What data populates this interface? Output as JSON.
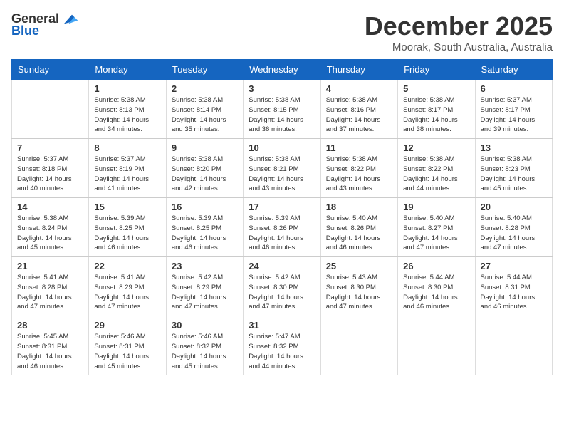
{
  "header": {
    "logo": {
      "general": "General",
      "blue": "Blue"
    },
    "title": "December 2025",
    "location": "Moorak, South Australia, Australia"
  },
  "days_of_week": [
    "Sunday",
    "Monday",
    "Tuesday",
    "Wednesday",
    "Thursday",
    "Friday",
    "Saturday"
  ],
  "weeks": [
    [
      {
        "day": "",
        "sunrise": "",
        "sunset": "",
        "daylight": ""
      },
      {
        "day": "1",
        "sunrise": "Sunrise: 5:38 AM",
        "sunset": "Sunset: 8:13 PM",
        "daylight": "Daylight: 14 hours and 34 minutes."
      },
      {
        "day": "2",
        "sunrise": "Sunrise: 5:38 AM",
        "sunset": "Sunset: 8:14 PM",
        "daylight": "Daylight: 14 hours and 35 minutes."
      },
      {
        "day": "3",
        "sunrise": "Sunrise: 5:38 AM",
        "sunset": "Sunset: 8:15 PM",
        "daylight": "Daylight: 14 hours and 36 minutes."
      },
      {
        "day": "4",
        "sunrise": "Sunrise: 5:38 AM",
        "sunset": "Sunset: 8:16 PM",
        "daylight": "Daylight: 14 hours and 37 minutes."
      },
      {
        "day": "5",
        "sunrise": "Sunrise: 5:38 AM",
        "sunset": "Sunset: 8:17 PM",
        "daylight": "Daylight: 14 hours and 38 minutes."
      },
      {
        "day": "6",
        "sunrise": "Sunrise: 5:37 AM",
        "sunset": "Sunset: 8:17 PM",
        "daylight": "Daylight: 14 hours and 39 minutes."
      }
    ],
    [
      {
        "day": "7",
        "sunrise": "Sunrise: 5:37 AM",
        "sunset": "Sunset: 8:18 PM",
        "daylight": "Daylight: 14 hours and 40 minutes."
      },
      {
        "day": "8",
        "sunrise": "Sunrise: 5:37 AM",
        "sunset": "Sunset: 8:19 PM",
        "daylight": "Daylight: 14 hours and 41 minutes."
      },
      {
        "day": "9",
        "sunrise": "Sunrise: 5:38 AM",
        "sunset": "Sunset: 8:20 PM",
        "daylight": "Daylight: 14 hours and 42 minutes."
      },
      {
        "day": "10",
        "sunrise": "Sunrise: 5:38 AM",
        "sunset": "Sunset: 8:21 PM",
        "daylight": "Daylight: 14 hours and 43 minutes."
      },
      {
        "day": "11",
        "sunrise": "Sunrise: 5:38 AM",
        "sunset": "Sunset: 8:22 PM",
        "daylight": "Daylight: 14 hours and 43 minutes."
      },
      {
        "day": "12",
        "sunrise": "Sunrise: 5:38 AM",
        "sunset": "Sunset: 8:22 PM",
        "daylight": "Daylight: 14 hours and 44 minutes."
      },
      {
        "day": "13",
        "sunrise": "Sunrise: 5:38 AM",
        "sunset": "Sunset: 8:23 PM",
        "daylight": "Daylight: 14 hours and 45 minutes."
      }
    ],
    [
      {
        "day": "14",
        "sunrise": "Sunrise: 5:38 AM",
        "sunset": "Sunset: 8:24 PM",
        "daylight": "Daylight: 14 hours and 45 minutes."
      },
      {
        "day": "15",
        "sunrise": "Sunrise: 5:39 AM",
        "sunset": "Sunset: 8:25 PM",
        "daylight": "Daylight: 14 hours and 46 minutes."
      },
      {
        "day": "16",
        "sunrise": "Sunrise: 5:39 AM",
        "sunset": "Sunset: 8:25 PM",
        "daylight": "Daylight: 14 hours and 46 minutes."
      },
      {
        "day": "17",
        "sunrise": "Sunrise: 5:39 AM",
        "sunset": "Sunset: 8:26 PM",
        "daylight": "Daylight: 14 hours and 46 minutes."
      },
      {
        "day": "18",
        "sunrise": "Sunrise: 5:40 AM",
        "sunset": "Sunset: 8:26 PM",
        "daylight": "Daylight: 14 hours and 46 minutes."
      },
      {
        "day": "19",
        "sunrise": "Sunrise: 5:40 AM",
        "sunset": "Sunset: 8:27 PM",
        "daylight": "Daylight: 14 hours and 47 minutes."
      },
      {
        "day": "20",
        "sunrise": "Sunrise: 5:40 AM",
        "sunset": "Sunset: 8:28 PM",
        "daylight": "Daylight: 14 hours and 47 minutes."
      }
    ],
    [
      {
        "day": "21",
        "sunrise": "Sunrise: 5:41 AM",
        "sunset": "Sunset: 8:28 PM",
        "daylight": "Daylight: 14 hours and 47 minutes."
      },
      {
        "day": "22",
        "sunrise": "Sunrise: 5:41 AM",
        "sunset": "Sunset: 8:29 PM",
        "daylight": "Daylight: 14 hours and 47 minutes."
      },
      {
        "day": "23",
        "sunrise": "Sunrise: 5:42 AM",
        "sunset": "Sunset: 8:29 PM",
        "daylight": "Daylight: 14 hours and 47 minutes."
      },
      {
        "day": "24",
        "sunrise": "Sunrise: 5:42 AM",
        "sunset": "Sunset: 8:30 PM",
        "daylight": "Daylight: 14 hours and 47 minutes."
      },
      {
        "day": "25",
        "sunrise": "Sunrise: 5:43 AM",
        "sunset": "Sunset: 8:30 PM",
        "daylight": "Daylight: 14 hours and 47 minutes."
      },
      {
        "day": "26",
        "sunrise": "Sunrise: 5:44 AM",
        "sunset": "Sunset: 8:30 PM",
        "daylight": "Daylight: 14 hours and 46 minutes."
      },
      {
        "day": "27",
        "sunrise": "Sunrise: 5:44 AM",
        "sunset": "Sunset: 8:31 PM",
        "daylight": "Daylight: 14 hours and 46 minutes."
      }
    ],
    [
      {
        "day": "28",
        "sunrise": "Sunrise: 5:45 AM",
        "sunset": "Sunset: 8:31 PM",
        "daylight": "Daylight: 14 hours and 46 minutes."
      },
      {
        "day": "29",
        "sunrise": "Sunrise: 5:46 AM",
        "sunset": "Sunset: 8:31 PM",
        "daylight": "Daylight: 14 hours and 45 minutes."
      },
      {
        "day": "30",
        "sunrise": "Sunrise: 5:46 AM",
        "sunset": "Sunset: 8:32 PM",
        "daylight": "Daylight: 14 hours and 45 minutes."
      },
      {
        "day": "31",
        "sunrise": "Sunrise: 5:47 AM",
        "sunset": "Sunset: 8:32 PM",
        "daylight": "Daylight: 14 hours and 44 minutes."
      },
      {
        "day": "",
        "sunrise": "",
        "sunset": "",
        "daylight": ""
      },
      {
        "day": "",
        "sunrise": "",
        "sunset": "",
        "daylight": ""
      },
      {
        "day": "",
        "sunrise": "",
        "sunset": "",
        "daylight": ""
      }
    ]
  ]
}
